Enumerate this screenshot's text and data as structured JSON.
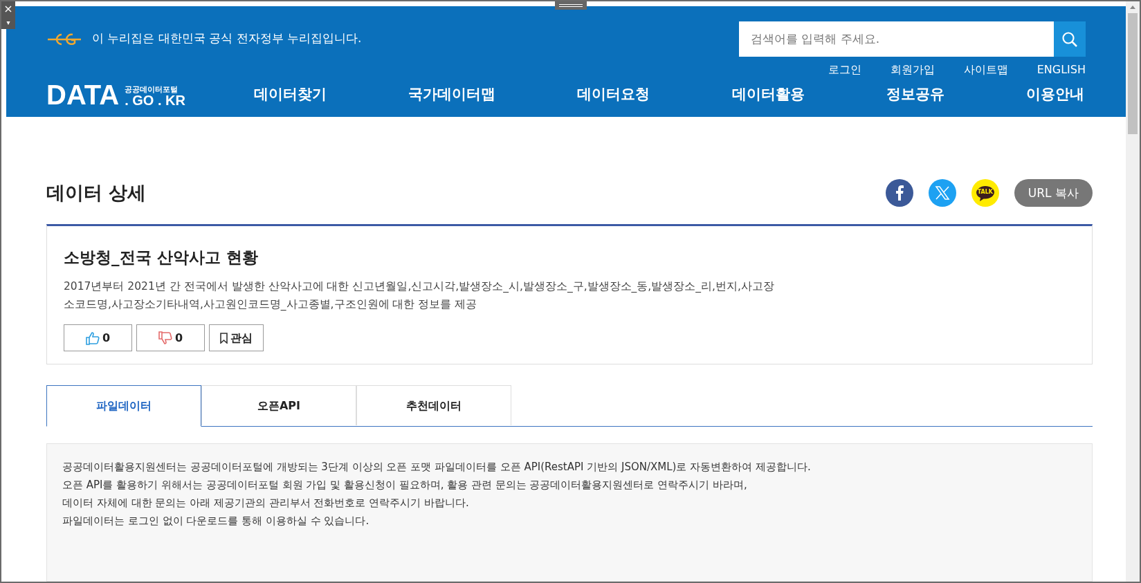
{
  "frame_controls": {
    "close": "×",
    "menu": "▾"
  },
  "header": {
    "notice": "이 누리집은 대한민국 공식 전자정부 누리집입니다.",
    "search": {
      "placeholder": "검색어를 입력해 주세요."
    },
    "util_links": [
      "로그인",
      "회원가입",
      "사이트맵",
      "ENGLISH"
    ],
    "logo": {
      "main": "DATA",
      "sub": "공공데이터포털",
      "domain": ". GO . KR"
    },
    "nav": [
      "데이터찾기",
      "국가데이터맵",
      "데이터요청",
      "데이터활용",
      "정보공유",
      "이용안내"
    ]
  },
  "page_title": "데이터 상세",
  "share": [
    {
      "kind": "facebook"
    },
    {
      "kind": "x"
    },
    {
      "kind": "kakao",
      "label": "TALK"
    }
  ],
  "url_copy": "URL 복사",
  "dataset": {
    "title": "소방청_전국 산악사고 현황",
    "description": [
      "2017년부터 2021년 간 전국에서 발생한 산악사고에 대한 신고년월일,신고시각,발생장소_시,발생장소_구,발생장소_동,발생장소_리,번지,사고장",
      "소코드명,사고장소기타내역,사고원인코드명_사고종별,구조인원에 대한 정보를 제공"
    ],
    "actions": [
      {
        "kind": "like",
        "count": "0"
      },
      {
        "kind": "dislike",
        "count": "0"
      },
      {
        "kind": "bookmark",
        "label": "관심"
      }
    ]
  },
  "tabs": [
    {
      "label": "파일데이터",
      "selected": true
    },
    {
      "label": "오픈API",
      "selected": false
    },
    {
      "label": "추천데이터",
      "selected": false
    }
  ],
  "info_lines": [
    "공공데이터활용지원센터는 공공데이터포털에 개방되는 3단계 이상의 오픈 포맷 파일데이터를 오픈 API(RestAPI 기반의 JSON/XML)로 자동변환하여 제공합니다.",
    "오픈 API를 활용하기 위해서는 공공데이터포털 회원 가입 및 활용신청이 필요하며, 활용 관련 문의는 공공데이터활용지원센터로 연락주시기 바라며,",
    "데이터 자체에 대한 문의는 아래 제공기관의 관리부서 전화번호로 연락주시기 바랍니다.",
    "파일데이터는 로그인 없이 다운로드를 통해 이용하실 수 있습니다."
  ]
}
